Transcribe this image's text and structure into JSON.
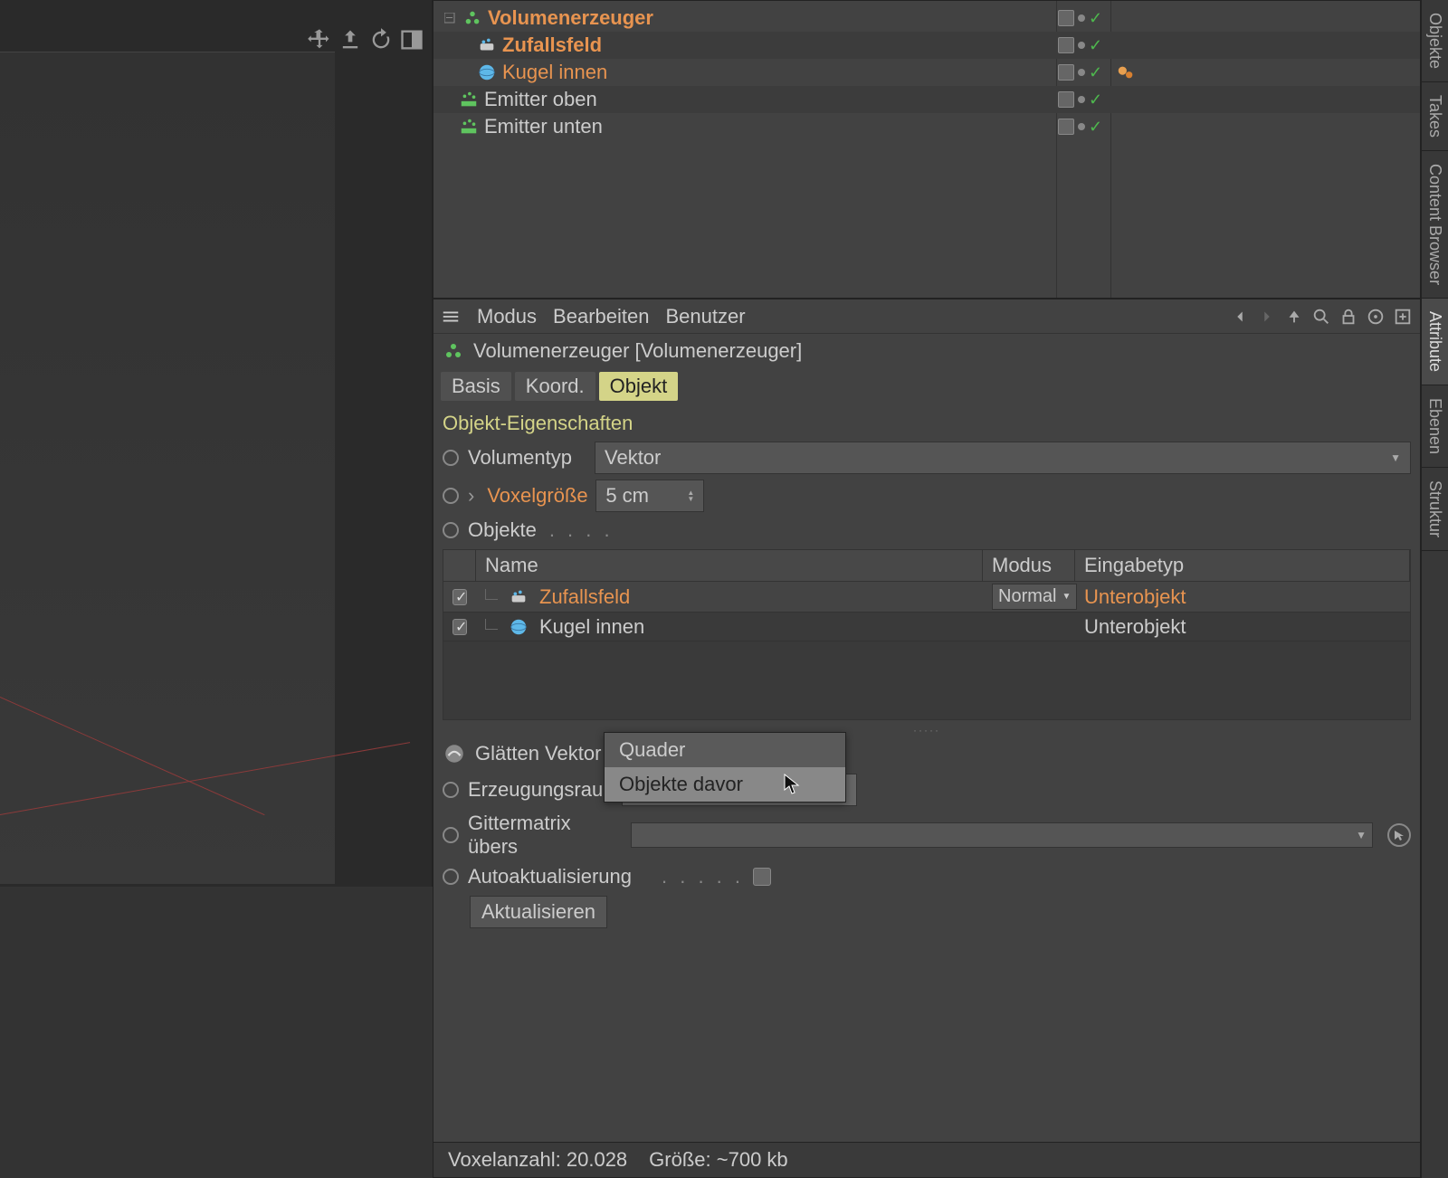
{
  "object_manager": {
    "rows": [
      {
        "label": "Volumenerzeuger",
        "style": "orange-bold"
      },
      {
        "label": "Zufallsfeld",
        "style": "orange-bold"
      },
      {
        "label": "Kugel innen",
        "style": "orange"
      },
      {
        "label": "Emitter oben",
        "style": ""
      },
      {
        "label": "Emitter unten",
        "style": ""
      }
    ]
  },
  "attr_toolbar": {
    "mode": "Modus",
    "edit": "Bearbeiten",
    "user": "Benutzer"
  },
  "attr_header": "Volumenerzeuger [Volumenerzeuger]",
  "tabs": {
    "basis": "Basis",
    "koord": "Koord.",
    "objekt": "Objekt"
  },
  "section": "Objekt-Eigenschaften",
  "props": {
    "volumentyp_label": "Volumentyp",
    "volumentyp_value": "Vektor",
    "voxelgroesse_label": "Voxelgröße",
    "voxelgroesse_value": "5 cm",
    "objekte_label": "Objekte"
  },
  "obj_table": {
    "head": {
      "name": "Name",
      "modus": "Modus",
      "eingabetyp": "Eingabetyp"
    },
    "rows": [
      {
        "name": "Zufallsfeld",
        "name_style": "orange",
        "modus": "Normal",
        "eingabetyp": "Unterobjekt",
        "eingabetyp_style": "orange"
      },
      {
        "name": "Kugel innen",
        "name_style": "",
        "modus": "",
        "eingabetyp": "Unterobjekt",
        "eingabetyp_style": ""
      }
    ]
  },
  "filter_label": "Glätten Vektor",
  "erzeugungsraum": {
    "label": "Erzeugungsraum",
    "value": "Objekte davor",
    "options": {
      "quader": "Quader",
      "objekte_davor": "Objekte davor"
    }
  },
  "gittermatrix_label": "Gittermatrix übers",
  "autoaktualisierung_label": "Autoaktualisierung",
  "aktualisieren_btn": "Aktualisieren",
  "status": {
    "voxel": "Voxelanzahl: 20.028",
    "size": "Größe: ~700 kb"
  },
  "side_tabs": {
    "objekte": "Objekte",
    "takes": "Takes",
    "content": "Content Browser",
    "attribute": "Attribute",
    "ebenen": "Ebenen",
    "struktur": "Struktur"
  }
}
